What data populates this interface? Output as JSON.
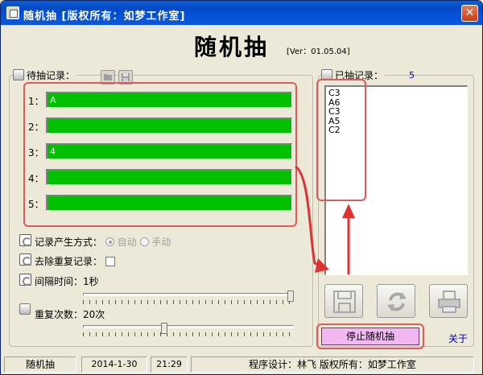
{
  "window": {
    "title": "随机抽   [版权所有：如梦工作室]",
    "close_glyph": "✕"
  },
  "header": {
    "title": "随机抽",
    "version": "[Ver：01.05.04]"
  },
  "pending": {
    "label": "待抽记录：",
    "rows": [
      {
        "index": "1：",
        "value": "A"
      },
      {
        "index": "2：",
        "value": ""
      },
      {
        "index": "3：",
        "value": "4"
      },
      {
        "index": "4：",
        "value": ""
      },
      {
        "index": "5：",
        "value": ""
      }
    ]
  },
  "options": {
    "mode_label": "记录产生方式：",
    "mode_auto": "自动",
    "mode_manual": "手动",
    "dedupe_label": "去除重复记录：",
    "interval_label": "间隔时间：1秒",
    "repeat_label": "重复次数：20次",
    "interval_fraction": 1.0,
    "repeat_fraction": 0.38
  },
  "drawn": {
    "label": "已抽记录：",
    "count": "5",
    "items": [
      "C3",
      "A6",
      "C3",
      "A5",
      "C2"
    ]
  },
  "buttons": {
    "stop": "停止随机抽",
    "about": "关于"
  },
  "status": {
    "app": "随机抽",
    "date": "2014-1-30",
    "time": "21:29",
    "credits": "程序设计：林飞  版权所有：如梦工作室"
  },
  "colors": {
    "bar_fill": "#00c000",
    "highlight": "#e05a5a",
    "stop_button": "#f2b8f2",
    "link": "#0000c8"
  }
}
